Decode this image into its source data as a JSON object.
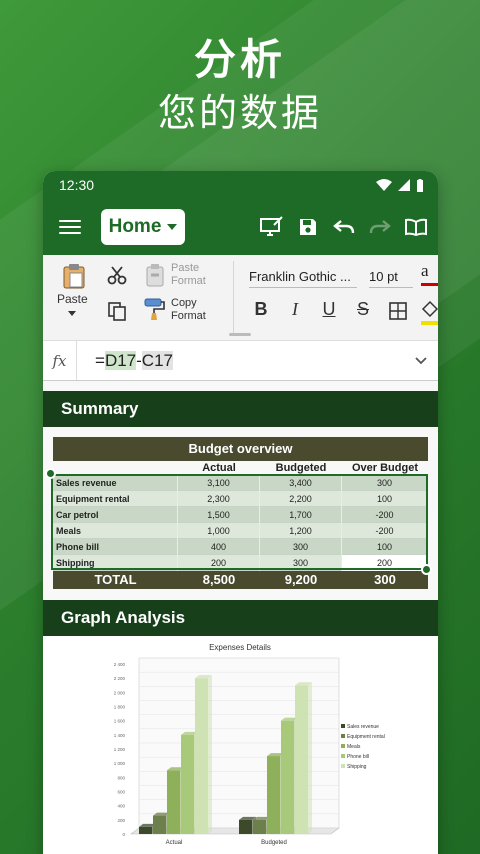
{
  "hero": {
    "line1": "分析",
    "line2": "您的数据"
  },
  "status": {
    "time": "12:30"
  },
  "appbar": {
    "home_label": "Home"
  },
  "ribbon": {
    "paste_label": "Paste",
    "paste_format": [
      "Paste",
      "Format"
    ],
    "copy_format": [
      "Copy",
      "Format"
    ],
    "font_name": "Franklin Gothic ...",
    "font_size": "10 pt",
    "bold": "B",
    "italic": "I",
    "underline": "U",
    "strike": "S"
  },
  "formula_bar": {
    "fx": "fx",
    "formula_part1": "=",
    "formula_ref1": "D17",
    "formula_minus": "-",
    "formula_ref2": "C17"
  },
  "summary": {
    "header": "Summary",
    "table_title": "Budget overview",
    "columns": [
      "",
      "Actual",
      "Budgeted",
      "Over Budget"
    ],
    "rows": [
      [
        "Sales revenue",
        "3,100",
        "3,400",
        "300"
      ],
      [
        "Equipment rental",
        "2,300",
        "2,200",
        "100"
      ],
      [
        "Car petrol",
        "1,500",
        "1,700",
        "-200"
      ],
      [
        "Meals",
        "1,000",
        "1,200",
        "-200"
      ],
      [
        "Phone bill",
        "400",
        "300",
        "100"
      ],
      [
        "Shipping",
        "200",
        "300",
        "200"
      ]
    ],
    "total": [
      "TOTAL",
      "8,500",
      "9,200",
      "300"
    ]
  },
  "graph": {
    "header": "Graph Analysis"
  },
  "chart_data": {
    "type": "bar",
    "title": "Expenses Details",
    "categories": [
      "Actual",
      "Budgeted"
    ],
    "y_ticks": [
      "0",
      "200",
      "400",
      "600",
      "800",
      "1 000",
      "1 200",
      "1 400",
      "1 600",
      "1 800",
      "2 000",
      "2 200",
      "2 400"
    ],
    "ylim": [
      0,
      2400
    ],
    "series": [
      {
        "name": "Sales revenue",
        "values": [
          100,
          200
        ],
        "color": "#3c4a2a"
      },
      {
        "name": "Equipment rental",
        "values": [
          260,
          200
        ],
        "color": "#6d7f4a"
      },
      {
        "name": "Meals",
        "values": [
          900,
          1100
        ],
        "color": "#8fb05a"
      },
      {
        "name": "Phone bill",
        "values": [
          1400,
          1600
        ],
        "color": "#a9c97a"
      },
      {
        "name": "Shipping",
        "values": [
          2200,
          2100
        ],
        "color": "#cfe2b4"
      }
    ]
  },
  "colors": {
    "brand_green": "#1e6b27",
    "dark_header": "#163f1a",
    "table_header": "#4a4a2e"
  }
}
